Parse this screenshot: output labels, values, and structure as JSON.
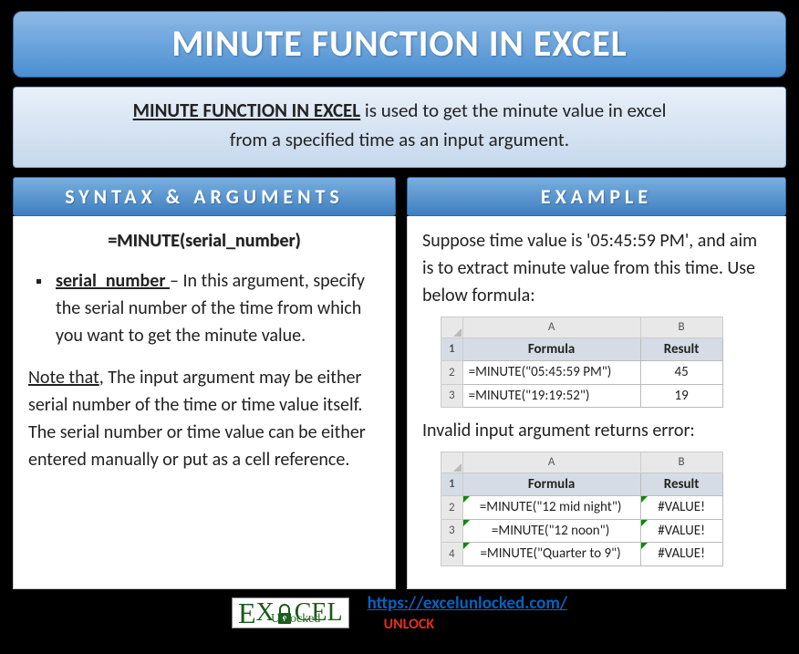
{
  "title": "MINUTE FUNCTION IN EXCEL",
  "description": {
    "strong": "MINUTE FUNCTION IN EXCEL",
    "rest1": " is used to get the minute value in excel",
    "rest2": "from a specified time as an input argument."
  },
  "syntax": {
    "header": "SYNTAX & ARGUMENTS",
    "formula": "=MINUTE(serial_number)",
    "arg_name": "serial_number ",
    "arg_desc": "– In this argument, specify the serial number of the time from which you want to get the minute value.",
    "note_label": "Note that",
    "note_text": ", The input argument may be either serial number of the time or time value itself. The serial number or time value can be either entered manually or put as a cell reference."
  },
  "example": {
    "header": "EXAMPLE",
    "intro": "Suppose time value is '05:45:59 PM', and aim is to extract minute value from this time. Use below formula:",
    "table1": {
      "colA_label": "A",
      "colB_label": "B",
      "header_formula": "Formula",
      "header_result": "Result",
      "rows": [
        {
          "n": "2",
          "formula": "=MINUTE(\"05:45:59 PM\")",
          "result": "45"
        },
        {
          "n": "3",
          "formula": "=MINUTE(\"19:19:52\")",
          "result": "19"
        }
      ]
    },
    "invalid_text": "Invalid input argument returns error:",
    "table2": {
      "colA_label": "A",
      "colB_label": "B",
      "header_formula": "Formula",
      "header_result": "Result",
      "rows": [
        {
          "n": "2",
          "formula": "=MINUTE(\"12 mid night\")",
          "result": "#VALUE!"
        },
        {
          "n": "3",
          "formula": "=MINUTE(\"12 noon\")",
          "result": "#VALUE!"
        },
        {
          "n": "4",
          "formula": "=MINUTE(\"Quarter to 9\")",
          "result": "#VALUE!"
        }
      ]
    }
  },
  "footer": {
    "logo_e1": "E",
    "logo_x": "X",
    "logo_cel": "CEL",
    "logo_sub": "Unlocked",
    "url": "https://excelunlocked.com/",
    "tag": "UNLOCK"
  }
}
